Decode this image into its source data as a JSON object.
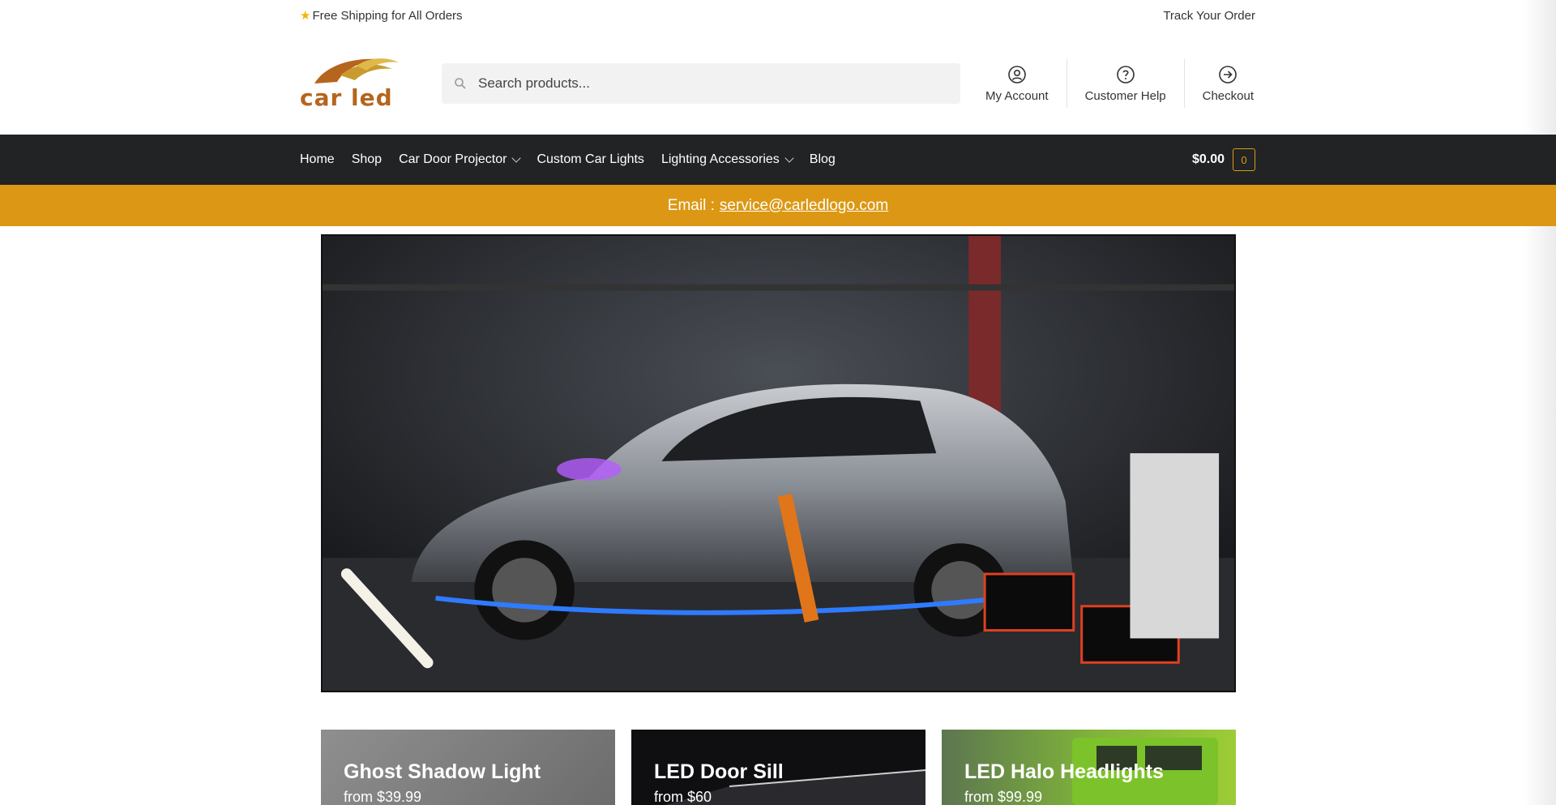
{
  "topbar": {
    "shipping_text": "Free Shipping for All Orders",
    "track_link": "Track Your Order"
  },
  "header": {
    "logo_text": "car led",
    "search_placeholder": "Search products...",
    "links": [
      {
        "label": "My Account",
        "icon": "user-icon"
      },
      {
        "label": "Customer Help",
        "icon": "help-icon"
      },
      {
        "label": "Checkout",
        "icon": "arrow-right-circle-icon"
      }
    ]
  },
  "nav": {
    "items": [
      {
        "label": "Home",
        "dropdown": false
      },
      {
        "label": "Shop",
        "dropdown": false
      },
      {
        "label": "Car Door Projector",
        "dropdown": true
      },
      {
        "label": "Custom Car Lights",
        "dropdown": false
      },
      {
        "label": "Lighting Accessories",
        "dropdown": true
      },
      {
        "label": "Blog",
        "dropdown": false
      }
    ],
    "cart_total": "$0.00",
    "cart_count": "0"
  },
  "banner": {
    "label": "Email :",
    "email": "service@carledlogo.com"
  },
  "categories": [
    {
      "title": "Ghost Shadow Light",
      "price": "from $39.99"
    },
    {
      "title": "LED Door Sill",
      "price": "from $60"
    },
    {
      "title": "LED Halo Headlights",
      "price": "from $99.99"
    }
  ],
  "colors": {
    "accent": "#dc9814",
    "nav_bg": "#222324"
  }
}
